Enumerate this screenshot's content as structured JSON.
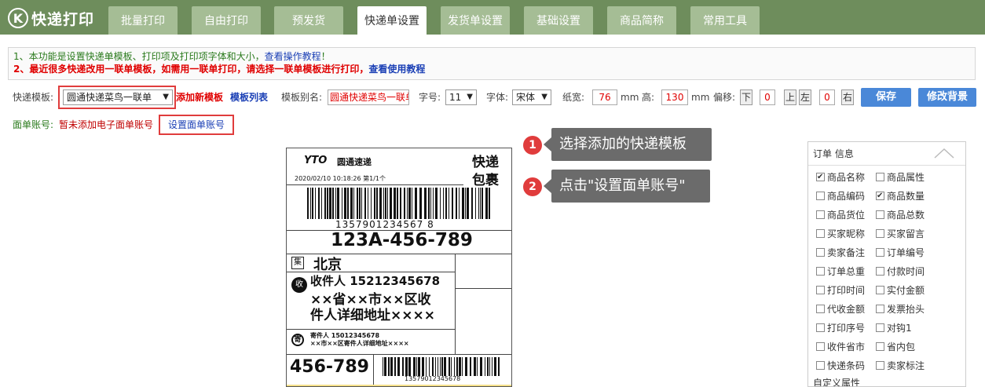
{
  "app": {
    "logo_letter": "K",
    "logo_text": "快递打印"
  },
  "tabs": [
    {
      "label": "批量打印"
    },
    {
      "label": "自由打印"
    },
    {
      "label": "预发货"
    },
    {
      "label": "快递单设置"
    },
    {
      "label": "发货单设置"
    },
    {
      "label": "基础设置"
    },
    {
      "label": "商品简称"
    },
    {
      "label": "常用工具"
    }
  ],
  "notice": {
    "line1_text": "1、本功能是设置快递单模板、打印项及打印项字体和大小，",
    "line1_link": "查看操作教程",
    "line1_end": "！",
    "line2_text": "2、最近很多快递改用一联单模板，如需用一联单打印，请选择一联单模板进行打印，",
    "line2_link": "查看使用教程"
  },
  "toolbar": {
    "template_label": "快递模板:",
    "template_value": "圆通快递菜鸟一联单",
    "add_template": "添加新模板",
    "template_list": "模板列表",
    "alias_label": "模板别名:",
    "alias_value": "圆通快递菜鸟一联单",
    "fontsize_label": "字号:",
    "fontsize_value": "11",
    "font_label": "字体:",
    "font_value": "宋体",
    "width_label": "纸宽:",
    "width_value": "76",
    "mm1": "mm",
    "height_label": "高:",
    "height_value": "130",
    "mm2": "mm",
    "offset_label": "偏移:",
    "down_btn": "下",
    "down_value": "0",
    "up_btn": "上",
    "left_btn": "左",
    "lr_value": "0",
    "right_btn": "右",
    "save_btn": "保存",
    "bg_btn": "修改背景"
  },
  "account": {
    "label": "面单账号:",
    "status": "暂未添加电子面单账号",
    "set_btn": "设置面单账号"
  },
  "callouts": [
    {
      "num": "1",
      "text": "选择添加的快递模板"
    },
    {
      "num": "2",
      "text": "点击\"设置面单账号\""
    }
  ],
  "label_preview": {
    "brand": "YTO",
    "brand_cn": "圆通速递",
    "title1": "快递",
    "title2": "包裹",
    "datetime": "2020/02/10   10:18:26   第1/1个",
    "barcode_num": "1357901234567 8",
    "route_code": "123A-456-789",
    "dest_tag": "集",
    "dest_city": "北京",
    "recv_tag": "收",
    "recv_line1": "收件人   15212345678",
    "recv_line2": "××省××市××区收",
    "recv_line3": "件人详细地址××××",
    "send_tag": "寄",
    "send_line1": "寄件人   15012345678",
    "send_line2": "××市××区寄件人详细地址××××",
    "bottom_code": "456-789",
    "bottom_barcode_num": "13579012345678"
  },
  "panel": {
    "header": "订单   信息",
    "items": [
      {
        "label": "商品名称",
        "checked": true
      },
      {
        "label": "商品属性",
        "checked": false
      },
      {
        "label": "商品编码",
        "checked": false
      },
      {
        "label": "商品数量",
        "checked": true
      },
      {
        "label": "商品货位",
        "checked": false
      },
      {
        "label": "商品总数",
        "checked": false
      },
      {
        "label": "买家昵称",
        "checked": false
      },
      {
        "label": "买家留言",
        "checked": false
      },
      {
        "label": "卖家备注",
        "checked": false
      },
      {
        "label": "订单编号",
        "checked": false
      },
      {
        "label": "订单总重",
        "checked": false
      },
      {
        "label": "付款时间",
        "checked": false
      },
      {
        "label": "打印时间",
        "checked": false
      },
      {
        "label": "实付金额",
        "checked": false
      },
      {
        "label": "代收金额",
        "checked": false
      },
      {
        "label": "发票抬头",
        "checked": false
      },
      {
        "label": "打印序号",
        "checked": false
      },
      {
        "label": "对钩1",
        "checked": false
      },
      {
        "label": "收件省市",
        "checked": false
      },
      {
        "label": "省内包",
        "checked": false
      },
      {
        "label": "快递条码",
        "checked": false
      },
      {
        "label": "卖家标注",
        "checked": false
      }
    ],
    "footer": "自定义属性"
  },
  "colors": {
    "topbar": "#6e8d5c",
    "tab": "#a5bd95",
    "accent_red": "#e03c3c",
    "btn_blue": "#4a88d8"
  }
}
